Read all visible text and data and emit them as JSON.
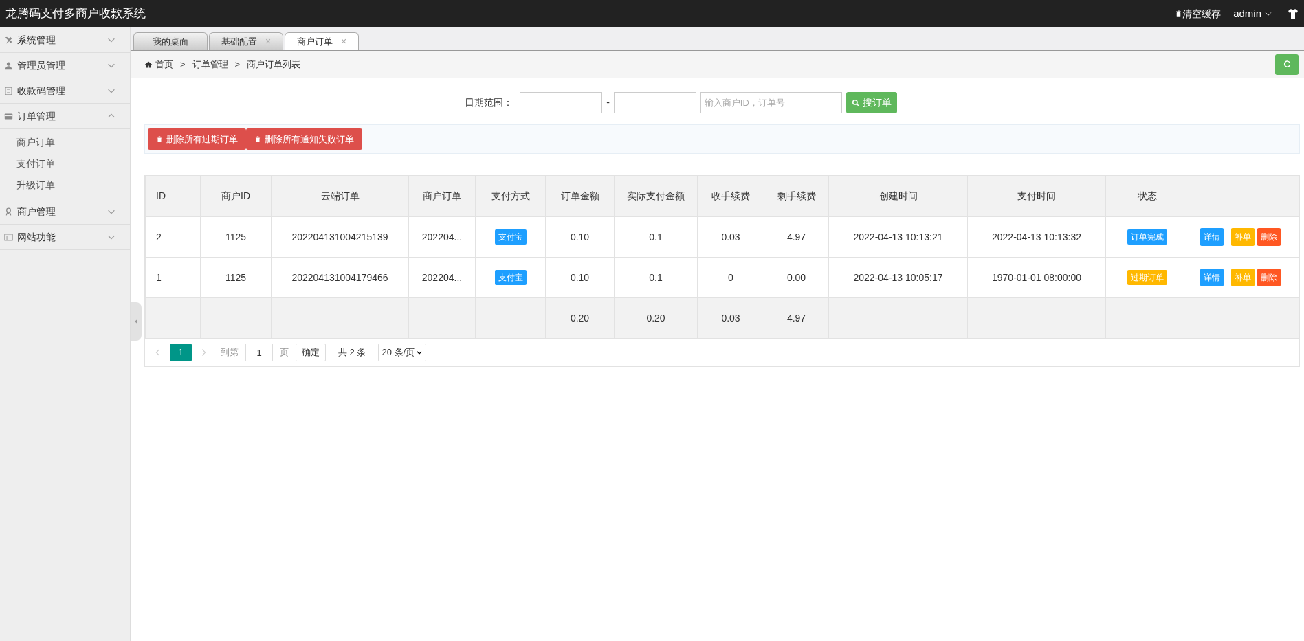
{
  "header": {
    "title": "龙腾码支付多商户收款系统",
    "clear_cache": "清空缓存",
    "user": "admin"
  },
  "sidebar": {
    "items": [
      {
        "label": "系统管理",
        "expanded": false
      },
      {
        "label": "管理员管理",
        "expanded": false
      },
      {
        "label": "收款码管理",
        "expanded": false
      },
      {
        "label": "订单管理",
        "expanded": true,
        "children": [
          {
            "label": "商户订单"
          },
          {
            "label": "支付订单"
          },
          {
            "label": "升级订单"
          }
        ]
      },
      {
        "label": "商户管理",
        "expanded": false
      },
      {
        "label": "网站功能",
        "expanded": false
      }
    ]
  },
  "tabs": [
    {
      "label": "我的桌面",
      "selected": false
    },
    {
      "label": "基础配置",
      "close": "×",
      "selected": false
    },
    {
      "label": "商户订单",
      "close": "×",
      "selected": true
    }
  ],
  "breadcrumb": [
    "首页",
    ">",
    "订单管理",
    ">",
    "商户订单列表"
  ],
  "search": {
    "label": "日期范围：",
    "separator": "-",
    "placeholder": "输入商户ID，订单号",
    "button": "搜订单"
  },
  "bulk_actions": [
    "删除所有过期订单",
    "删除所有通知失败订单"
  ],
  "table": {
    "columns": [
      "ID",
      "商户ID",
      "云端订单",
      "商户订单",
      "支付方式",
      "订单金额",
      "实际支付金额",
      "收手续费",
      "剩手续费",
      "创建时间",
      "支付时间",
      "状态"
    ],
    "rows": [
      {
        "cells": [
          "2",
          "1125",
          "202204131004215139",
          "202204...",
          null,
          "0.10",
          "0.1",
          "0.03",
          "4.97",
          "2022-04-13 10:13:21",
          "2022-04-13 10:13:32",
          null
        ],
        "payment": "支付宝",
        "status": {
          "label": "订单完成",
          "color": "#1e9fff"
        },
        "actions": [
          {
            "label": "详情",
            "color": "#1e9fff"
          },
          {
            "label": "补单",
            "color": "#ffb800"
          },
          {
            "label": "删除",
            "color": "#ff5722"
          }
        ]
      },
      {
        "cells": [
          "1",
          "1125",
          "202204131004179466",
          "202204...",
          null,
          "0.10",
          "0.1",
          "0",
          "0.00",
          "2022-04-13 10:05:17",
          "1970-01-01 08:00:00",
          null
        ],
        "payment": "支付宝",
        "status": {
          "label": "过期订单",
          "color": "#ffb800"
        },
        "actions": [
          {
            "label": "详情",
            "color": "#1e9fff"
          },
          {
            "label": "补单",
            "color": "#ffb800"
          },
          {
            "label": "删除",
            "color": "#ff5722"
          }
        ]
      }
    ],
    "totals": {
      "order_amount": "0.20",
      "paid_amount": "0.20",
      "fee_charged": "0.03",
      "fee_remaining": "4.97"
    }
  },
  "pagination": {
    "pages": [
      {
        "label": "1",
        "selected": true
      }
    ],
    "goto_label": "到第",
    "goto_value": "1",
    "page_unit": "页",
    "confirm": "确定",
    "total": "共 2 条",
    "page_size": "20 条/页"
  }
}
